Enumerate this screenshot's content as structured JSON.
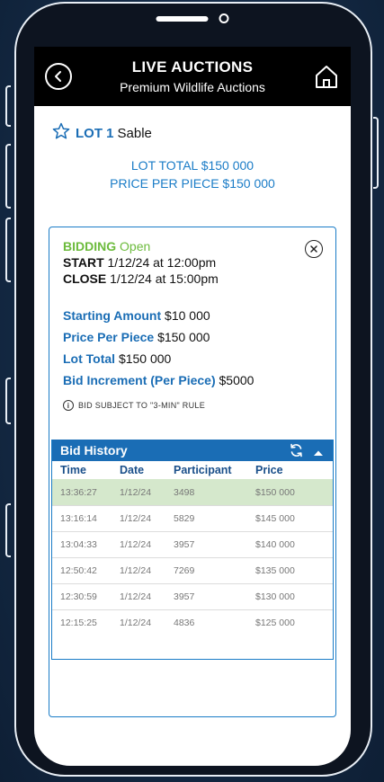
{
  "header": {
    "title": "LIVE AUCTIONS",
    "subtitle": "Premium Wildlife Auctions"
  },
  "lot": {
    "number_label": "LOT 1",
    "name": "Sable",
    "total": "LOT TOTAL $150 000",
    "price_per_piece": "PRICE PER PIECE $150 000"
  },
  "bidding": {
    "status_label": "BIDDING",
    "status_value": "Open",
    "start_label": "START",
    "start_value": "1/12/24 at 12:00pm",
    "close_label": "CLOSE",
    "close_value": "1/12/24 at 15:00pm"
  },
  "details": {
    "starting_amount_label": "Starting Amount",
    "starting_amount_value": "$10 000",
    "price_per_piece_label": "Price Per Piece",
    "price_per_piece_value": "$150 000",
    "lot_total_label": "Lot Total",
    "lot_total_value": "$150 000",
    "bid_increment_label": "Bid Increment (Per Piece)",
    "bid_increment_value": "$5000"
  },
  "rule_text": "BID SUBJECT TO \"3-MIN\" RULE",
  "history": {
    "title": "Bid History",
    "columns": [
      "Time",
      "Date",
      "Participant",
      "Price"
    ],
    "rows": [
      [
        "13:36:27",
        "1/12/24",
        "3498",
        "$150 000"
      ],
      [
        "13:16:14",
        "1/12/24",
        "5829",
        "$145 000"
      ],
      [
        "13:04:33",
        "1/12/24",
        "3957",
        "$140 000"
      ],
      [
        "12:50:42",
        "1/12/24",
        "7269",
        "$135 000"
      ],
      [
        "12:30:59",
        "1/12/24",
        "3957",
        "$130 000"
      ],
      [
        "12:15:25",
        "1/12/24",
        "4836",
        "$125 000"
      ]
    ]
  },
  "colors": {
    "accent_blue": "#1a6db5",
    "open_green": "#6cbb3c",
    "highlight_row": "#d5e8cc"
  }
}
